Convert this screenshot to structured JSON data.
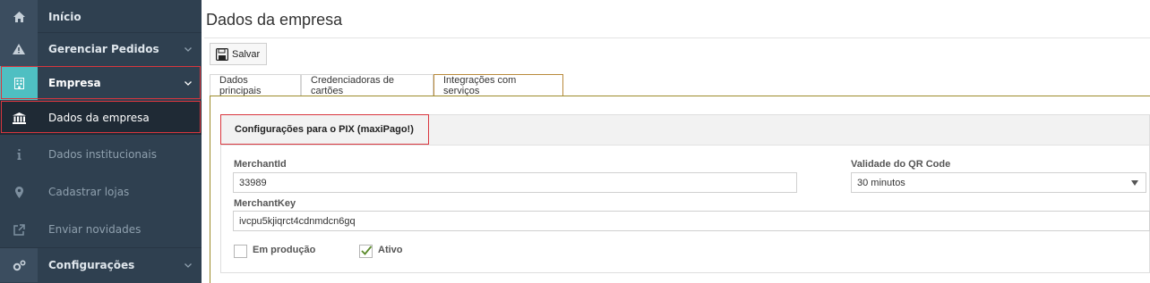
{
  "sidebar": {
    "items": [
      {
        "label": "Início",
        "icon": "home-icon"
      },
      {
        "label": "Gerenciar Pedidos",
        "icon": "warning-icon"
      },
      {
        "label": "Empresa",
        "icon": "building-icon"
      },
      {
        "label": "Dados da empresa",
        "icon": "bank-icon"
      },
      {
        "label": "Dados institucionais",
        "icon": "info-icon"
      },
      {
        "label": "Cadastrar lojas",
        "icon": "map-marker-icon"
      },
      {
        "label": "Enviar novidades",
        "icon": "external-link-icon"
      },
      {
        "label": "Configurações",
        "icon": "cogs-icon"
      }
    ]
  },
  "main": {
    "title": "Dados da empresa",
    "toolbar": {
      "save_label": "Salvar"
    },
    "tabs": [
      "Dados principais",
      "Credenciadoras de cartões",
      "Integrações com serviços"
    ],
    "section": {
      "title": "Configurações para o PIX (maxiPago!)",
      "merchant_id_label": "MerchantId",
      "merchant_id_value": "33989",
      "qr_validity_label": "Validade do QR Code",
      "qr_validity_value": "30 minutos",
      "merchant_key_label": "MerchantKey",
      "merchant_key_value": "ivcpu5kjiqrct4cdnmdcn6gq",
      "production_label": "Em produção",
      "production_checked": false,
      "active_label": "Ativo",
      "active_checked": true
    }
  },
  "colors": {
    "sidebar_bg": "#2f4050",
    "accent_teal": "#4fbfc2",
    "highlight_red": "#d9363e",
    "tab_selected_border": "#b8893a"
  }
}
